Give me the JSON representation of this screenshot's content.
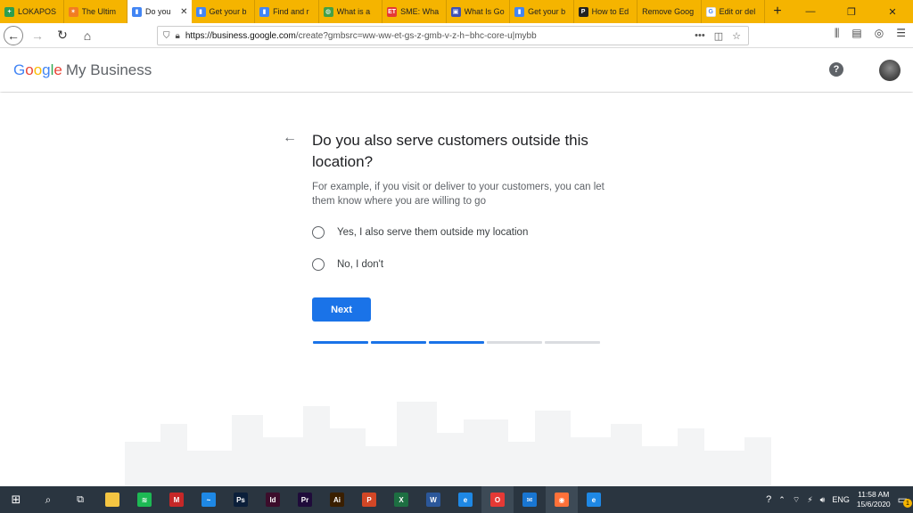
{
  "browser": {
    "tabs": [
      {
        "label": "LOKAPOS",
        "color": "#2e9e4f",
        "glyph": "+"
      },
      {
        "label": "The Ultim",
        "color": "#f27c22",
        "glyph": "✶"
      },
      {
        "label": "Do you",
        "color": "#4285f4",
        "glyph": "▮",
        "active": true
      },
      {
        "label": "Get your b",
        "color": "#4285f4",
        "glyph": "▮"
      },
      {
        "label": "Find and r",
        "color": "#4285f4",
        "glyph": "▮"
      },
      {
        "label": "What is a",
        "color": "#43a047",
        "glyph": "◍"
      },
      {
        "label": "SME: Wha",
        "color": "#e53935",
        "glyph": "ET"
      },
      {
        "label": "What Is Go",
        "color": "#3f51b5",
        "glyph": "▣"
      },
      {
        "label": "Get your b",
        "color": "#4285f4",
        "glyph": "▮"
      },
      {
        "label": "How to Ed",
        "color": "#222222",
        "glyph": "P"
      },
      {
        "label": "Remove Goog",
        "color": "",
        "glyph": ""
      },
      {
        "label": "Edit or del",
        "color": "#ffffff",
        "glyph": "G"
      }
    ],
    "new_tab": "+",
    "url_host": "https://business.google.com",
    "url_path": "/create?gmbsrc=ww-ww-et-gs-z-gmb-v-z-h~bhc-core-u|mybb",
    "url_actions": "•••",
    "window_controls": [
      "—",
      "❐",
      "✕"
    ]
  },
  "app": {
    "brand_letters": [
      "G",
      "o",
      "o",
      "g",
      "l",
      "e"
    ],
    "brand_suffix": "My Business",
    "help_glyph": "?"
  },
  "form": {
    "question": "Do you also serve customers outside this location?",
    "help_text": "For example, if you visit or deliver to your customers, you can let them know where you are willing to go",
    "options": [
      {
        "label": "Yes, I also serve them outside my location"
      },
      {
        "label": "No, I don't"
      }
    ],
    "next_label": "Next",
    "progress": {
      "total_steps": 5,
      "completed_steps": 3
    }
  },
  "taskbar": {
    "apps": [
      {
        "name": "file-explorer",
        "color": "#f4c542",
        "glyph": ""
      },
      {
        "name": "spotify",
        "color": "#1db954",
        "glyph": "≋"
      },
      {
        "name": "mcafee",
        "color": "#c62828",
        "glyph": "M"
      },
      {
        "name": "app-blue",
        "color": "#1e88e5",
        "glyph": "~"
      },
      {
        "name": "photoshop",
        "color": "#0b1f3a",
        "glyph": "Ps"
      },
      {
        "name": "indesign",
        "color": "#3c0d2b",
        "glyph": "Id"
      },
      {
        "name": "premiere",
        "color": "#1f0b3a",
        "glyph": "Pr"
      },
      {
        "name": "illustrator",
        "color": "#3a1f00",
        "glyph": "Ai"
      },
      {
        "name": "powerpoint",
        "color": "#d24726",
        "glyph": "P"
      },
      {
        "name": "excel",
        "color": "#1d6f42",
        "glyph": "X"
      },
      {
        "name": "word",
        "color": "#2b579a",
        "glyph": "W"
      },
      {
        "name": "internet-explorer",
        "color": "#1e88e5",
        "glyph": "e"
      },
      {
        "name": "opera",
        "color": "#e53935",
        "glyph": "O"
      },
      {
        "name": "mail",
        "color": "#1976d2",
        "glyph": "✉"
      },
      {
        "name": "firefox",
        "color": "#ff7139",
        "glyph": "◉"
      },
      {
        "name": "edge",
        "color": "#1e88e5",
        "glyph": "e"
      }
    ],
    "language": "ENG",
    "time": "11:58 AM",
    "date": "15/6/2020",
    "notification_count": "1"
  }
}
